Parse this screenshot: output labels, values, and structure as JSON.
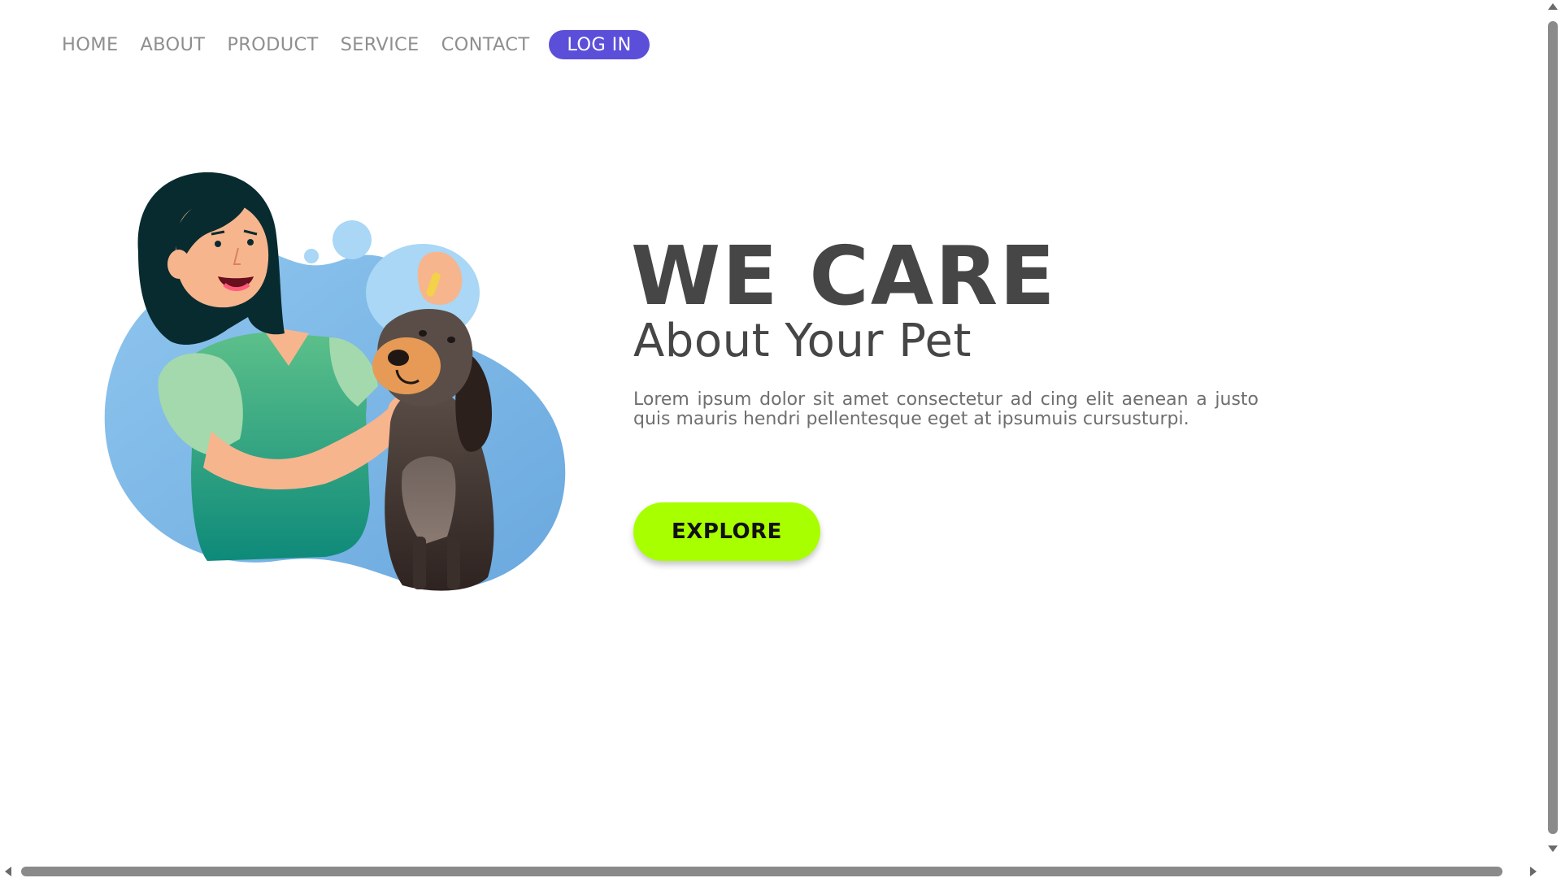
{
  "nav": {
    "items": [
      {
        "label": "HOME"
      },
      {
        "label": "ABOUT"
      },
      {
        "label": "PRODUCT"
      },
      {
        "label": "SERVICE"
      },
      {
        "label": "CONTACT"
      }
    ],
    "login_label": "LOG IN"
  },
  "hero": {
    "title": "WE CARE",
    "subtitle": "About Your Pet",
    "description": "Lorem ipsum dolor sit amet consectetur ad cing elit aenean a justo quis mauris hendri pellentesque eget at ipsumuis cursusturpi.",
    "cta_label": "EXPLORE"
  },
  "illustration": {
    "icon": "woman-with-dog-illustration"
  },
  "colors": {
    "background": "#ffffff",
    "nav_text": "#8f8f8f",
    "login_bg": "#5b4fd9",
    "heading_text": "#464646",
    "body_text": "#6f6f6f",
    "cta_bg": "#a8ff00",
    "cta_text": "#111111"
  }
}
